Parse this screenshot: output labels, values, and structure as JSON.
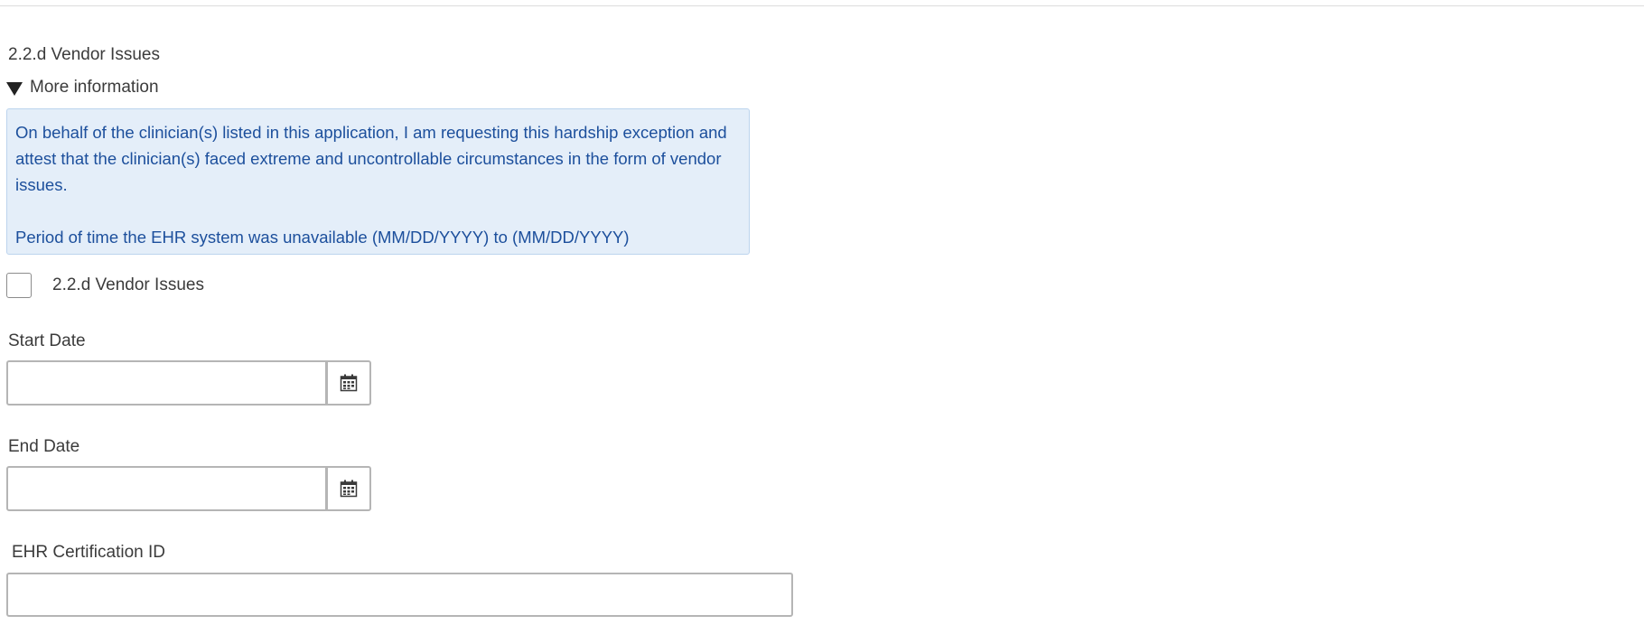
{
  "section": {
    "title": "2.2.d Vendor Issues"
  },
  "more_info": {
    "toggle_label": "More information",
    "expanded": true,
    "paragraph_1": "On behalf of the clinician(s) listed in this application, I am requesting this hardship exception and attest that the clinician(s) faced extreme and uncontrollable circumstances in the form of vendor issues.",
    "paragraph_2": "Period of time the EHR system was unavailable (MM/DD/YYYY) to (MM/DD/YYYY)"
  },
  "checkbox": {
    "label": "2.2.d Vendor Issues",
    "checked": false
  },
  "start_date": {
    "label": "Start Date",
    "value": "",
    "icon": "calendar-icon"
  },
  "end_date": {
    "label": "End Date",
    "value": "",
    "icon": "calendar-icon"
  },
  "ehr_cert": {
    "label": "EHR Certification ID",
    "value": ""
  },
  "colors": {
    "info_bg": "#e4eef9",
    "info_border": "#bcd4ee",
    "info_text": "#1c4f9c",
    "input_border": "#b5b5b5"
  }
}
